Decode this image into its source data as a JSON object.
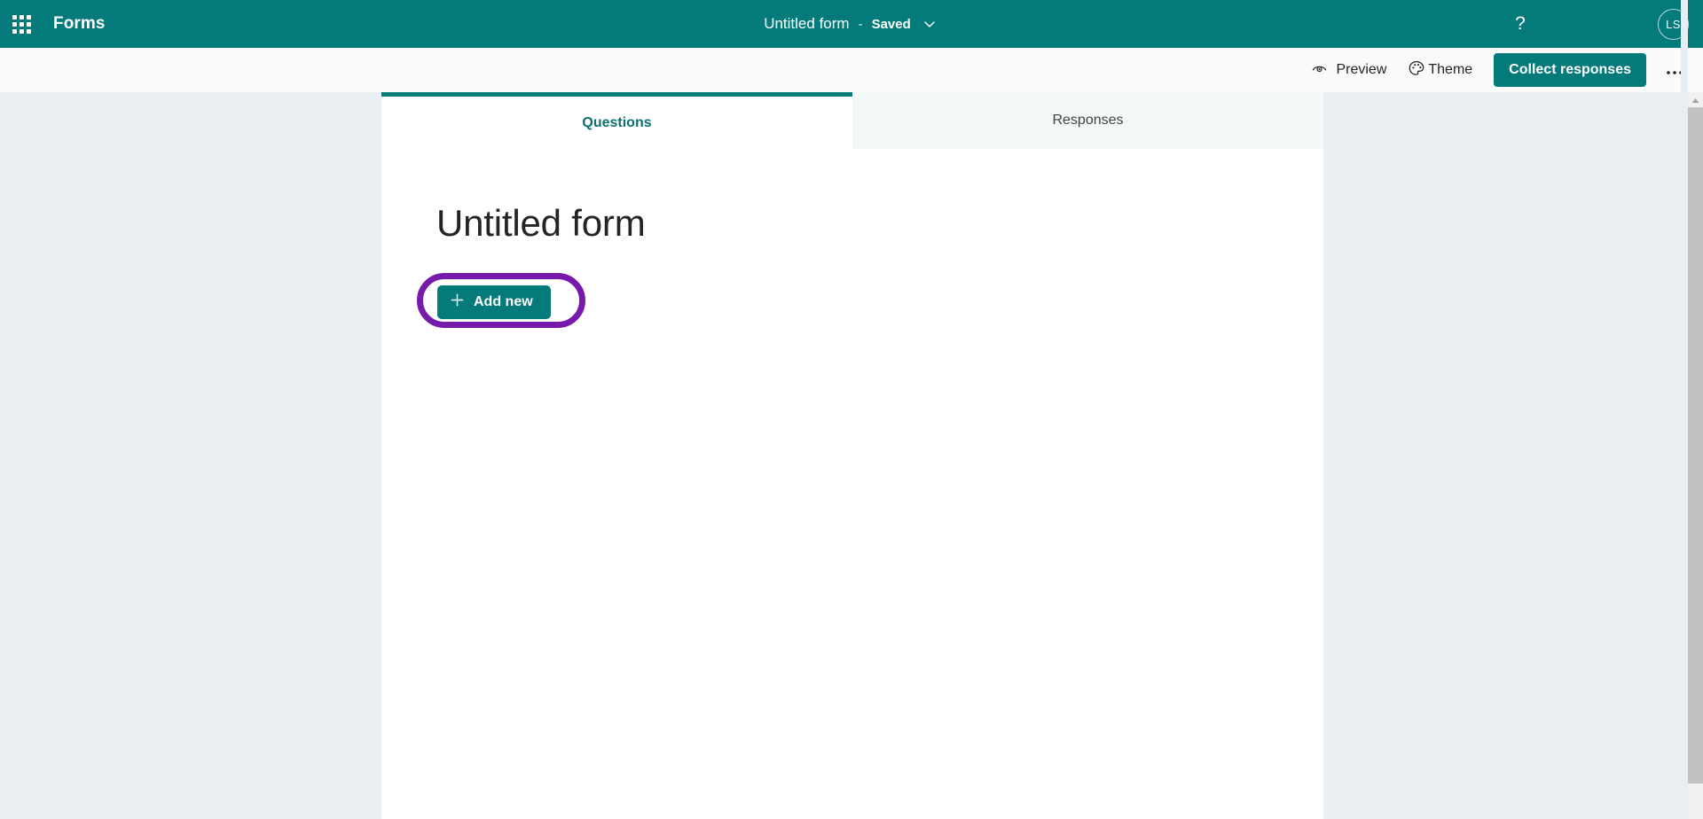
{
  "header": {
    "app_launcher_icon": "waffle-grid-icon",
    "app_name": "Forms",
    "document_title": "Untitled form",
    "separator": "-",
    "save_status": "Saved",
    "title_menu_icon": "chevron-down-icon",
    "help_icon": "question-mark-icon",
    "help_label": "?",
    "avatar_initials": "LS",
    "bar_color": "#057a7a"
  },
  "toolbar": {
    "preview_label": "Preview",
    "preview_icon": "eye-icon",
    "theme_label": "Theme",
    "theme_icon": "palette-icon",
    "collect_responses_label": "Collect responses",
    "more_options_label": "•••",
    "more_options_icon": "ellipsis-icon",
    "primary_color": "#057a7a",
    "background": "#fafafa"
  },
  "tabs": [
    {
      "label": "Questions",
      "active": true
    },
    {
      "label": "Responses",
      "active": false
    }
  ],
  "form": {
    "title": "Untitled form",
    "add_new_label": "Add new",
    "add_new_icon": "plus-icon",
    "highlight_color": "#7719aa"
  },
  "scrollbar": {
    "up_arrow_icon": "caret-up-icon",
    "thumb_color": "#c1c1c1"
  },
  "page": {
    "background": "#e8eef1",
    "panel_background": "#ffffff"
  }
}
